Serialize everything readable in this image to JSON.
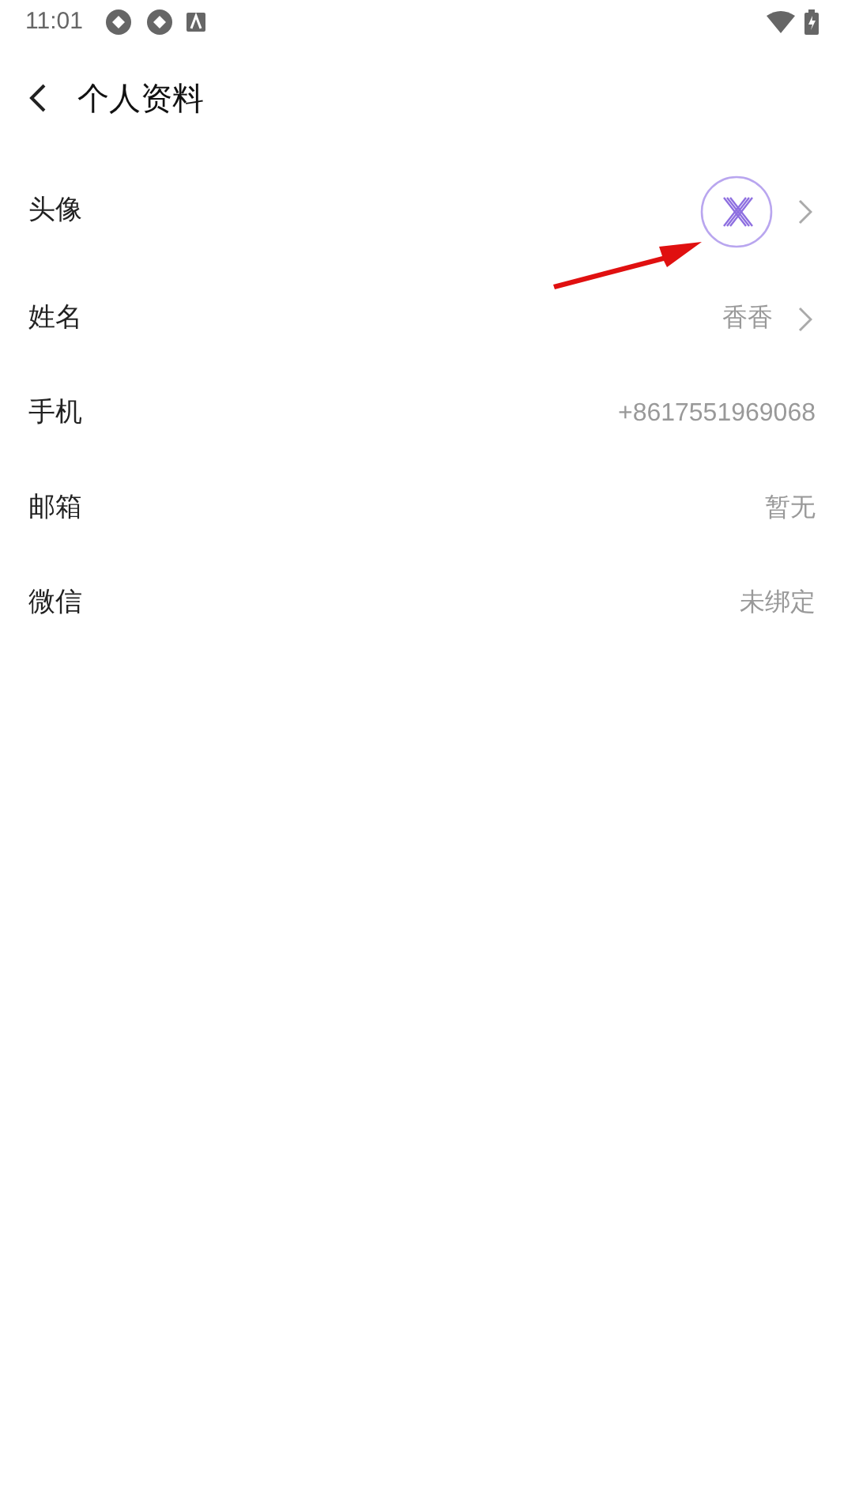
{
  "status_bar": {
    "time": "11:01"
  },
  "header": {
    "title": "个人资料"
  },
  "rows": [
    {
      "kind": "avatar",
      "label": "头像",
      "chevron": true
    },
    {
      "kind": "text",
      "label": "姓名",
      "value": "香香",
      "chevron": true
    },
    {
      "kind": "text",
      "label": "手机",
      "value": "+8617551969068",
      "chevron": false
    },
    {
      "kind": "text",
      "label": "邮箱",
      "value": "暂无",
      "chevron": false
    },
    {
      "kind": "text",
      "label": "微信",
      "value": "未绑定",
      "chevron": false
    }
  ]
}
